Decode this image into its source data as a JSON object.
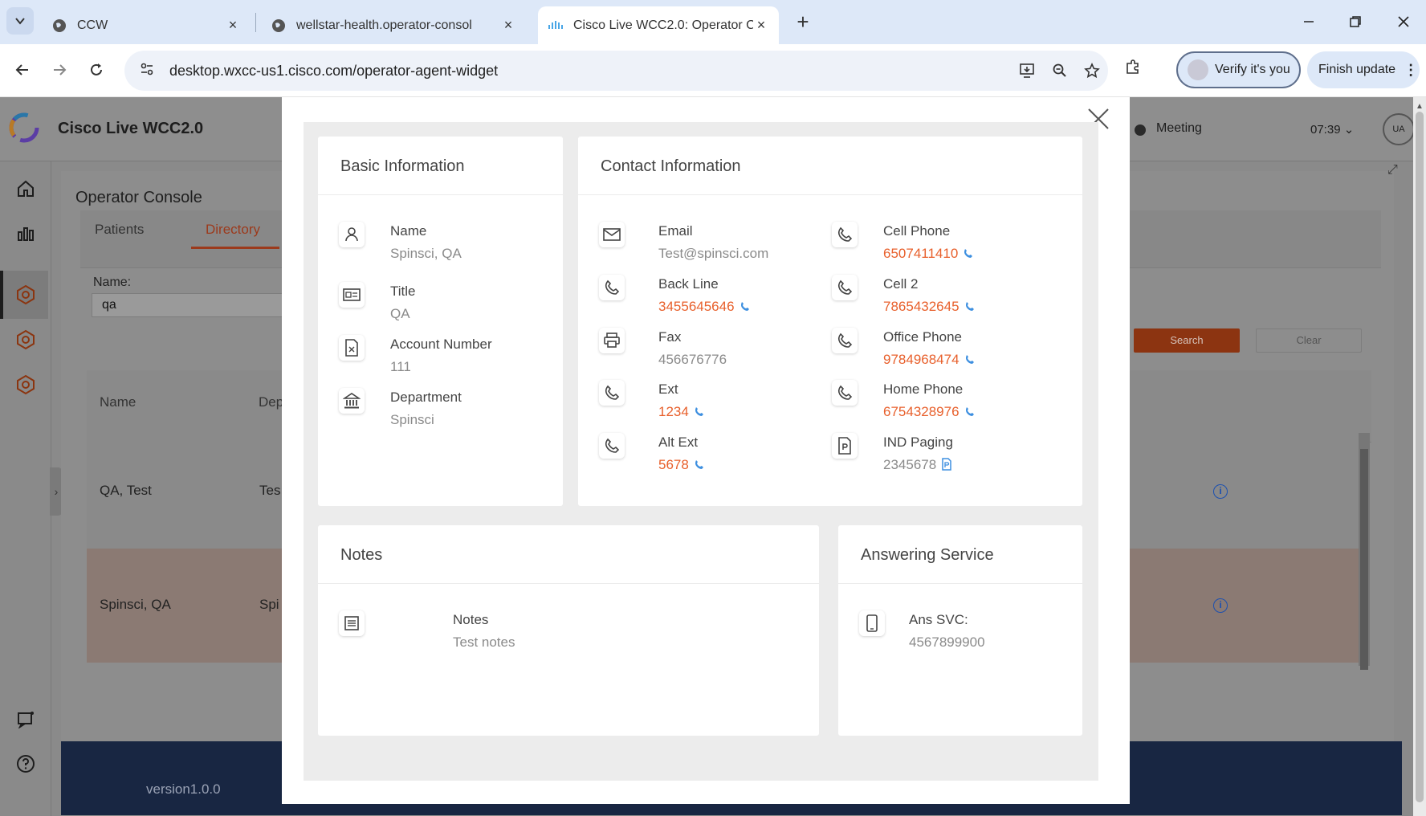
{
  "browser": {
    "tabs": [
      {
        "title": "CCW",
        "close": "×"
      },
      {
        "title": "wellstar-health.operator-consol",
        "close": "×"
      },
      {
        "title": "Cisco Live WCC2.0: Operator Co",
        "close": "×"
      }
    ],
    "new_tab": "+",
    "url": "desktop.wxcc-us1.cisco.com/operator-agent-widget",
    "verify_label": "Verify it's you",
    "finish_label": "Finish update"
  },
  "app": {
    "title": "Cisco Live WCC2.0",
    "status": "Meeting",
    "timer": "07:39",
    "avatar_initials": "UA",
    "console_title": "Operator Console",
    "tabs": {
      "patients": "Patients",
      "directory": "Directory"
    },
    "search": {
      "name_label": "Name:",
      "name_value": "qa",
      "search_btn": "Search",
      "clear_btn": "Clear"
    },
    "table": {
      "columns": [
        "Name",
        "Dep"
      ],
      "rows": [
        {
          "name": "QA, Test",
          "dept": "Tes"
        },
        {
          "name": "Spinsci, QA",
          "dept": "Spi"
        }
      ]
    },
    "version": "version1.0.0"
  },
  "modal": {
    "close": "╳",
    "basic": {
      "title": "Basic Information",
      "name": {
        "label": "Name",
        "value": "Spinsci, QA"
      },
      "job_title": {
        "label": "Title",
        "value": "QA"
      },
      "account": {
        "label": "Account Number",
        "value": "111"
      },
      "department": {
        "label": "Department",
        "value": "Spinsci"
      }
    },
    "contact": {
      "title": "Contact Information",
      "email": {
        "label": "Email",
        "value": "Test@spinsci.com"
      },
      "back_line": {
        "label": "Back Line",
        "value": "3455645646"
      },
      "fax": {
        "label": "Fax",
        "value": "456676776"
      },
      "ext": {
        "label": "Ext",
        "value": "1234"
      },
      "alt_ext": {
        "label": "Alt Ext",
        "value": "5678"
      },
      "cell_phone": {
        "label": "Cell Phone",
        "value": "6507411410"
      },
      "cell2": {
        "label": "Cell 2",
        "value": "7865432645"
      },
      "office_phone": {
        "label": "Office Phone",
        "value": "9784968474"
      },
      "home_phone": {
        "label": "Home Phone",
        "value": "6754328976"
      },
      "ind_paging": {
        "label": "IND Paging",
        "value": "2345678"
      }
    },
    "notes": {
      "title": "Notes",
      "label": "Notes",
      "value": "Test notes"
    },
    "answering": {
      "title": "Answering Service",
      "label": "Ans SVC:",
      "value": "4567899900"
    }
  },
  "colors": {
    "link": "#e8602c",
    "accent_blue": "#3d8fe0",
    "footer": "#182642",
    "tab_strip": "#dde8f8"
  }
}
